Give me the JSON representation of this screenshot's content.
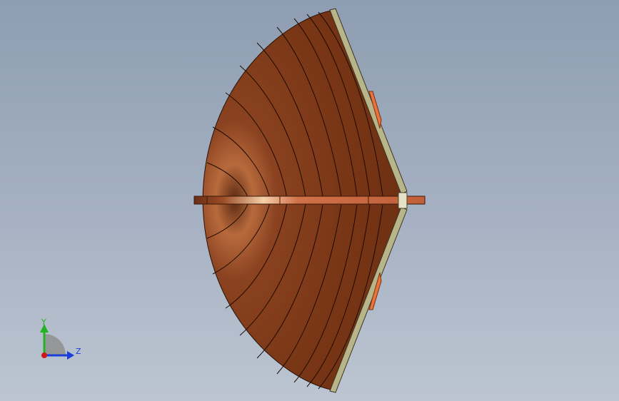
{
  "viewport": {
    "background_top": "#8e9db2",
    "background_bottom": "#bcc5d1"
  },
  "model": {
    "icon": "horn-antenna-model",
    "body_color": "#7a3a1a",
    "body_highlight": "#b0603a",
    "rim_color": "#b9b58a",
    "flange_color": "#e8743c",
    "feed_color": "#c8653c"
  },
  "triad": {
    "y_label": "Y",
    "z_label": "Z",
    "y_color": "#22b422",
    "z_color": "#1a3ed8",
    "x_color": "#d01818"
  }
}
